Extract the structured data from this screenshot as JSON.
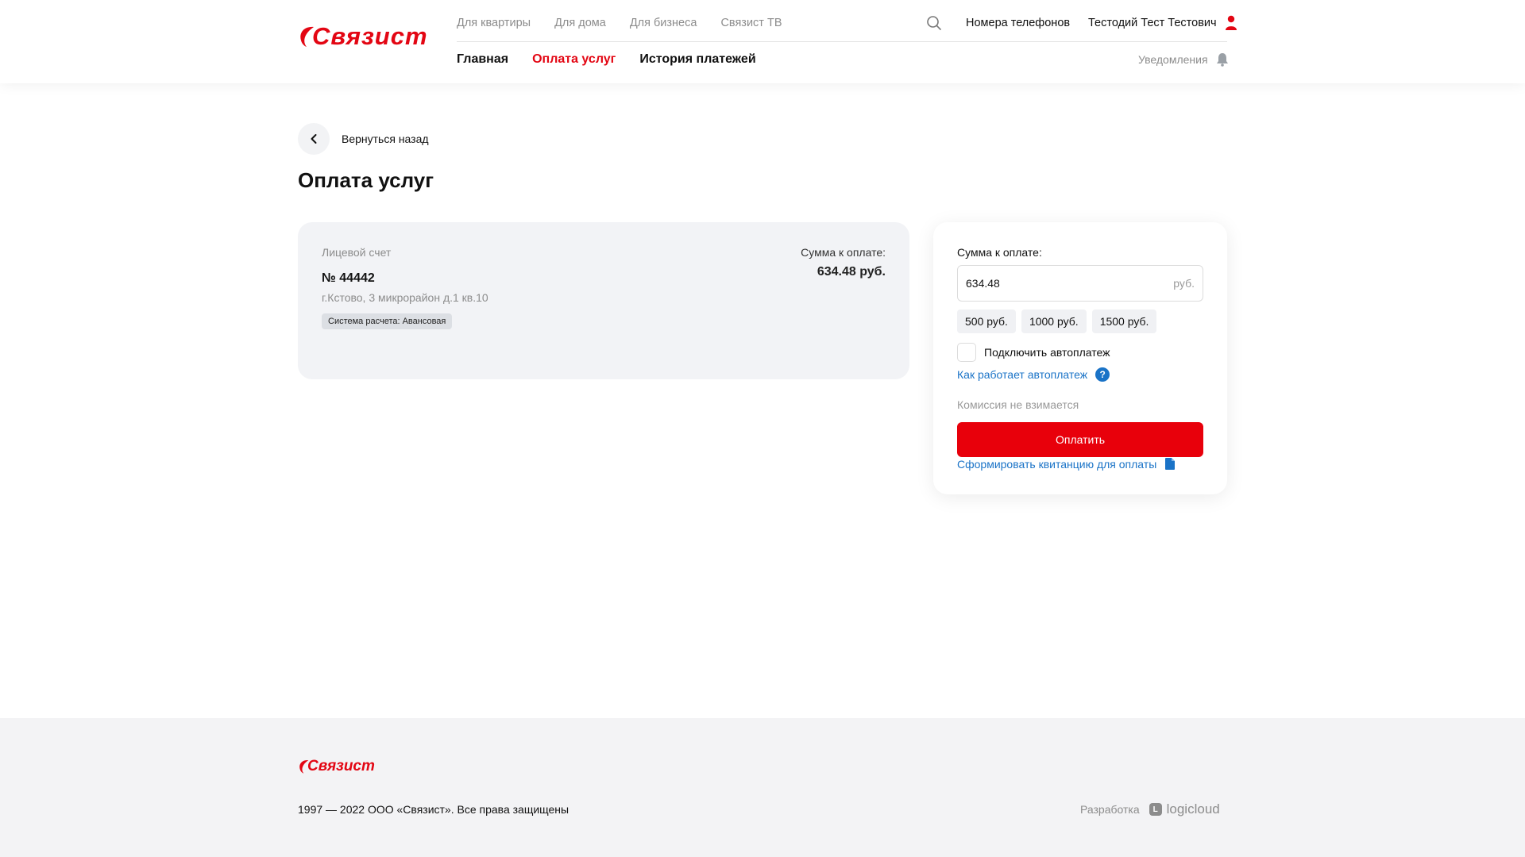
{
  "brand": {
    "name": "Связист",
    "color": "#e30613"
  },
  "header": {
    "top_nav": [
      "Для квартиры",
      "Для дома",
      "Для бизнеса",
      "Связист ТВ"
    ],
    "phones_link": "Номера телефонов",
    "user_name": "Тестодий Тест Тестович",
    "main_nav": [
      {
        "label": "Главная",
        "active": false
      },
      {
        "label": "Оплата услуг",
        "active": true
      },
      {
        "label": "История платежей",
        "active": false
      }
    ],
    "notifications_label": "Уведомления"
  },
  "back_label": "Вернуться назад",
  "page_title": "Оплата услуг",
  "account": {
    "label": "Лицевой счет",
    "number": "№ 44442",
    "address": "г.Кстово, 3 микрорайон д.1 кв.10",
    "billing_badge": "Система расчета: Авансовая",
    "sum_label": "Сумма к оплате:",
    "sum_value": "634.48 руб."
  },
  "payment": {
    "label": "Сумма к оплате:",
    "amount_value": "634.48",
    "currency": "руб.",
    "presets": [
      "500 руб.",
      "1000 руб.",
      "1500 руб."
    ],
    "autopay_label": "Подключить автоплатеж",
    "autopay_checked": false,
    "autopay_help": "Как работает автоплатеж",
    "commission": "Комиссия не взимается",
    "pay_button": "Оплатить",
    "receipt_link": "Сформировать квитанцию для оплаты"
  },
  "footer": {
    "copyright": "1997 — 2022 ООО «Связист». Все права защищены",
    "dev_label": "Разработка",
    "dev_brand": "logicloud"
  },
  "colors": {
    "accent": "#e30613",
    "link": "#1a73c7",
    "card_bg": "#f2f3f6"
  },
  "icons": [
    "search-icon",
    "user-icon",
    "bell-icon",
    "chevron-left-icon",
    "question-icon",
    "document-icon",
    "logo-swoosh-icon",
    "logicloud-icon"
  ]
}
